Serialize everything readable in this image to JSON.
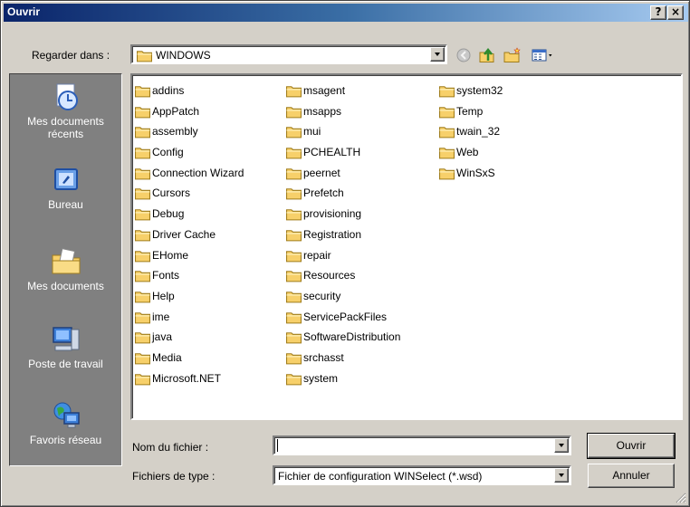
{
  "window": {
    "title": "Ouvrir",
    "help_label": "?",
    "close_label": "×"
  },
  "lookin": {
    "label": "Regarder dans :",
    "value": "WINDOWS"
  },
  "toolbar": {
    "icons": [
      "back-icon",
      "up-folder-icon",
      "new-folder-icon",
      "view-menu-icon"
    ]
  },
  "places": [
    {
      "label": "Mes documents récents",
      "icon": "recent-documents-icon"
    },
    {
      "label": "Bureau",
      "icon": "desktop-icon"
    },
    {
      "label": "Mes documents",
      "icon": "my-documents-icon"
    },
    {
      "label": "Poste de travail",
      "icon": "my-computer-icon"
    },
    {
      "label": "Favoris réseau",
      "icon": "network-places-icon"
    }
  ],
  "files": {
    "col1": [
      "addins",
      "AppPatch",
      "assembly",
      "Config",
      "Connection Wizard",
      "Cursors",
      "Debug",
      "Driver Cache",
      "EHome",
      "Fonts",
      "Help",
      "ime",
      "java",
      "Media",
      "Microsoft.NET"
    ],
    "col2": [
      "msagent",
      "msapps",
      "mui",
      "PCHEALTH",
      "peernet",
      "Prefetch",
      "provisioning",
      "Registration",
      "repair",
      "Resources",
      "security",
      "ServicePackFiles",
      "SoftwareDistribution",
      "srchasst",
      "system"
    ],
    "col3": [
      "system32",
      "Temp",
      "twain_32",
      "Web",
      "WinSxS"
    ]
  },
  "filename": {
    "label": "Nom du fichier :",
    "value": "",
    "placeholder": ""
  },
  "filetype": {
    "label": "Fichiers de type :",
    "value": "Fichier de configuration WINSelect (*.wsd)"
  },
  "buttons": {
    "open": "Ouvrir",
    "cancel": "Annuler"
  },
  "colors": {
    "titlebar_start": "#0a246a",
    "titlebar_end": "#a6caf0",
    "face": "#d4d0c8",
    "places_bg": "#808080",
    "folder": "#f5d26b"
  }
}
